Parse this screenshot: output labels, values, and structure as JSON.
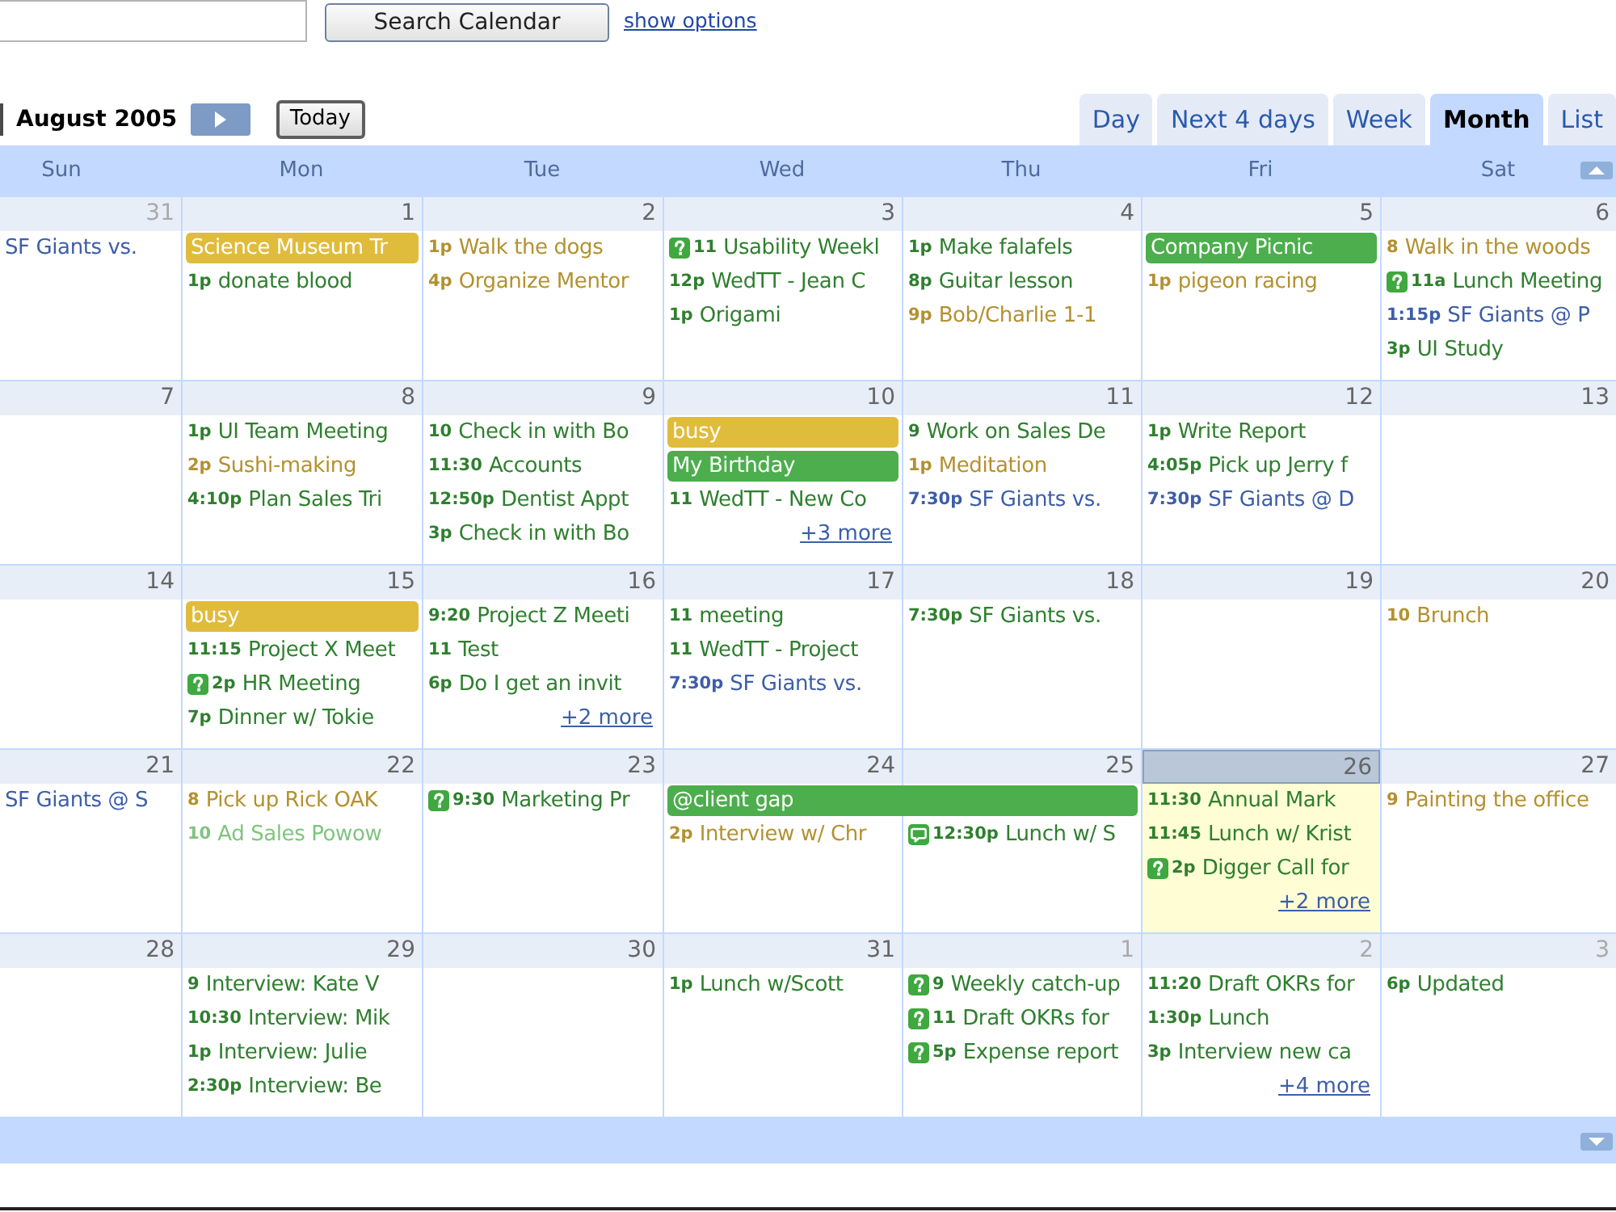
{
  "search": {
    "button": "Search Calendar",
    "link": "show options"
  },
  "navigation": {
    "title": "August 2005",
    "today_button": "Today"
  },
  "views": [
    {
      "label": "Day",
      "selected": false
    },
    {
      "label": "Next 4 days",
      "selected": false
    },
    {
      "label": "Week",
      "selected": false
    },
    {
      "label": "Month",
      "selected": true
    },
    {
      "label": "List",
      "selected": false
    }
  ],
  "weekdays": [
    "Sun",
    "Mon",
    "Tue",
    "Wed",
    "Thu",
    "Fri",
    "Sat"
  ],
  "weeks": [
    {
      "days": [
        {
          "date": "31",
          "outside": true,
          "today": false,
          "events": [
            {
              "kind": "text",
              "title": "SF Giants vs.",
              "color": "#3d5ea8"
            }
          ]
        },
        {
          "date": "1",
          "outside": false,
          "today": false,
          "events": [
            {
              "kind": "chip",
              "title": "Science Museum Tr",
              "color": "#e0bc3c",
              "continues": false
            },
            {
              "kind": "text",
              "time": "1p",
              "title": "donate blood",
              "color": "#2f7f2f"
            }
          ]
        },
        {
          "date": "2",
          "outside": false,
          "today": false,
          "events": [
            {
              "kind": "text",
              "time": "1p",
              "title": "Walk the dogs",
              "color": "#b3912f"
            },
            {
              "kind": "text",
              "time": "4p",
              "title": "Organize Mentor",
              "color": "#b3912f"
            }
          ]
        },
        {
          "date": "3",
          "outside": false,
          "today": false,
          "events": [
            {
              "kind": "invite",
              "time": "11",
              "title": "Usability Weekl",
              "color": "#2f7f2f"
            },
            {
              "kind": "text",
              "time": "12p",
              "title": "WedTT - Jean C",
              "color": "#2f7f2f"
            },
            {
              "kind": "text",
              "time": "1p",
              "title": "Origami",
              "color": "#2f7f2f"
            }
          ]
        },
        {
          "date": "4",
          "outside": false,
          "today": false,
          "events": [
            {
              "kind": "text",
              "time": "1p",
              "title": "Make falafels",
              "color": "#2f7f2f"
            },
            {
              "kind": "text",
              "time": "8p",
              "title": "Guitar lesson",
              "color": "#2f7f2f"
            },
            {
              "kind": "text",
              "time": "9p",
              "title": "Bob/Charlie 1-1",
              "color": "#b3912f"
            }
          ]
        },
        {
          "date": "5",
          "outside": false,
          "today": false,
          "events": [
            {
              "kind": "chip",
              "title": "Company Picnic",
              "color": "#4cae4c",
              "continues": false
            },
            {
              "kind": "text",
              "time": "1p",
              "title": "pigeon racing",
              "color": "#b3912f"
            }
          ]
        },
        {
          "date": "6",
          "outside": false,
          "today": false,
          "events": [
            {
              "kind": "text",
              "time": "8",
              "title": "Walk in the woods",
              "color": "#b3912f"
            },
            {
              "kind": "invite",
              "time": "11a",
              "title": "Lunch Meeting",
              "color": "#2f7f2f"
            },
            {
              "kind": "text",
              "time": "1:15p",
              "title": "SF Giants @ P",
              "color": "#3d5ea8"
            },
            {
              "kind": "text",
              "time": "3p",
              "title": "UI Study",
              "color": "#2f7f2f"
            }
          ]
        }
      ]
    },
    {
      "days": [
        {
          "date": "7",
          "outside": false,
          "today": false
        },
        {
          "date": "8",
          "outside": false,
          "today": false,
          "events": [
            {
              "kind": "text",
              "time": "1p",
              "title": "UI Team Meeting",
              "color": "#2f7f2f"
            },
            {
              "kind": "text",
              "time": "2p",
              "title": "Sushi-making",
              "color": "#b3912f"
            },
            {
              "kind": "text",
              "time": "4:10p",
              "title": "Plan Sales Tri",
              "color": "#2f7f2f"
            }
          ]
        },
        {
          "date": "9",
          "outside": false,
          "today": false,
          "events": [
            {
              "kind": "text",
              "time": "10",
              "title": "Check in with Bo",
              "color": "#2f7f2f"
            },
            {
              "kind": "text",
              "time": "11:30",
              "title": "Accounts",
              "color": "#2f7f2f"
            },
            {
              "kind": "text",
              "time": "12:50p",
              "title": "Dentist Appt",
              "color": "#2f7f2f"
            },
            {
              "kind": "text",
              "time": "3p",
              "title": "Check in with Bo",
              "color": "#2f7f2f"
            }
          ]
        },
        {
          "date": "10",
          "outside": false,
          "today": false,
          "events": [
            {
              "kind": "chip",
              "title": "busy",
              "color": "#e0bc3c",
              "continues": false
            },
            {
              "kind": "chip",
              "title": "My Birthday",
              "color": "#4cae4c",
              "continues": false
            },
            {
              "kind": "text",
              "time": "11",
              "title": "WedTT - New Co",
              "color": "#2f7f2f"
            }
          ],
          "more": "+3 more"
        },
        {
          "date": "11",
          "outside": false,
          "today": false,
          "events": [
            {
              "kind": "text",
              "time": "9",
              "title": "Work on Sales De",
              "color": "#2f7f2f"
            },
            {
              "kind": "text",
              "time": "1p",
              "title": "Meditation",
              "color": "#b3912f"
            },
            {
              "kind": "text",
              "time": "7:30p",
              "title": "SF Giants vs.",
              "color": "#3d5ea8"
            }
          ]
        },
        {
          "date": "12",
          "outside": false,
          "today": false,
          "events": [
            {
              "kind": "text",
              "time": "1p",
              "title": "Write Report",
              "color": "#2f7f2f"
            },
            {
              "kind": "text",
              "time": "4:05p",
              "title": "Pick up Jerry f",
              "color": "#2f7f2f"
            },
            {
              "kind": "text",
              "time": "7:30p",
              "title": "SF Giants @ D",
              "color": "#3d5ea8"
            }
          ]
        },
        {
          "date": "13",
          "outside": false,
          "today": false
        }
      ]
    },
    {
      "days": [
        {
          "date": "14",
          "outside": false,
          "today": false
        },
        {
          "date": "15",
          "outside": false,
          "today": false,
          "events": [
            {
              "kind": "chip",
              "title": "busy",
              "color": "#e0bc3c",
              "continues": false
            },
            {
              "kind": "text",
              "time": "11:15",
              "title": "Project X Meet",
              "color": "#2f7f2f"
            },
            {
              "kind": "invite",
              "time": "2p",
              "title": "HR Meeting",
              "color": "#2f7f2f"
            },
            {
              "kind": "text",
              "time": "7p",
              "title": "Dinner w/ Tokie",
              "color": "#2f7f2f"
            }
          ]
        },
        {
          "date": "16",
          "outside": false,
          "today": false,
          "events": [
            {
              "kind": "text",
              "time": "9:20",
              "title": "Project Z Meeti",
              "color": "#2f7f2f"
            },
            {
              "kind": "text",
              "time": "11",
              "title": "Test",
              "color": "#2f7f2f"
            },
            {
              "kind": "text",
              "time": "6p",
              "title": "Do I get an invit",
              "color": "#2f7f2f"
            }
          ],
          "more": "+2 more"
        },
        {
          "date": "17",
          "outside": false,
          "today": false,
          "events": [
            {
              "kind": "text",
              "time": "11",
              "title": "meeting",
              "color": "#2f7f2f"
            },
            {
              "kind": "text",
              "time": "11",
              "title": "WedTT - Project",
              "color": "#2f7f2f"
            },
            {
              "kind": "text",
              "time": "7:30p",
              "title": "SF Giants vs.",
              "color": "#3d5ea8"
            }
          ]
        },
        {
          "date": "18",
          "outside": false,
          "today": false,
          "events": [
            {
              "kind": "text",
              "time": "7:30p",
              "title": "SF Giants vs.",
              "color": "#2f7f2f"
            }
          ]
        },
        {
          "date": "19",
          "outside": false,
          "today": false
        },
        {
          "date": "20",
          "outside": false,
          "today": false,
          "events": [
            {
              "kind": "text",
              "time": "10",
              "title": "Brunch",
              "color": "#b3912f"
            }
          ]
        }
      ]
    },
    {
      "days": [
        {
          "date": "21",
          "outside": false,
          "today": false,
          "events": [
            {
              "kind": "text",
              "title": "SF Giants @ S",
              "color": "#3d5ea8"
            }
          ]
        },
        {
          "date": "22",
          "outside": false,
          "today": false,
          "events": [
            {
              "kind": "text",
              "time": "8",
              "title": "Pick up Rick OAK",
              "color": "#b3912f"
            },
            {
              "kind": "text",
              "time": "10",
              "title": "Ad Sales Powow",
              "color": "#7fc47f"
            }
          ]
        },
        {
          "date": "23",
          "outside": false,
          "today": false,
          "events": [
            {
              "kind": "invite",
              "time": "9:30",
              "title": "Marketing Pr",
              "color": "#2f7f2f"
            }
          ]
        },
        {
          "date": "24",
          "outside": false,
          "today": false,
          "events": [
            {
              "kind": "chip",
              "title": "@client gap",
              "color": "#4cae4c",
              "continues": true
            },
            {
              "kind": "text",
              "time": "2p",
              "title": "Interview w/ Chr",
              "color": "#b3912f"
            }
          ]
        },
        {
          "date": "25",
          "outside": false,
          "today": false,
          "events": [
            {
              "kind": "chat",
              "time": "12:30p",
              "title": "Lunch w/ S",
              "color": "#2f7f2f"
            }
          ]
        },
        {
          "date": "26",
          "outside": false,
          "today": true,
          "events": [
            {
              "kind": "text",
              "time": "11:30",
              "title": "Annual Mark",
              "color": "#2f7f2f"
            },
            {
              "kind": "text",
              "time": "11:45",
              "title": "Lunch w/ Krist",
              "color": "#2f7f2f"
            },
            {
              "kind": "invite",
              "time": "2p",
              "title": "Digger Call for",
              "color": "#2f7f2f"
            }
          ],
          "more": "+2 more"
        },
        {
          "date": "27",
          "outside": false,
          "today": false,
          "events": [
            {
              "kind": "text",
              "time": "9",
              "title": "Painting the office",
              "color": "#b3912f"
            }
          ]
        }
      ]
    },
    {
      "days": [
        {
          "date": "28",
          "outside": false,
          "today": false
        },
        {
          "date": "29",
          "outside": false,
          "today": false,
          "events": [
            {
              "kind": "text",
              "time": "9",
              "title": "Interview: Kate V",
              "color": "#2f7f2f"
            },
            {
              "kind": "text",
              "time": "10:30",
              "title": "Interview: Mik",
              "color": "#2f7f2f"
            },
            {
              "kind": "text",
              "time": "1p",
              "title": "Interview: Julie",
              "color": "#2f7f2f"
            },
            {
              "kind": "text",
              "time": "2:30p",
              "title": "Interview: Be",
              "color": "#2f7f2f"
            }
          ]
        },
        {
          "date": "30",
          "outside": false,
          "today": false
        },
        {
          "date": "31",
          "outside": false,
          "today": false,
          "events": [
            {
              "kind": "text",
              "time": "1p",
              "title": "Lunch w/Scott",
              "color": "#2f7f2f"
            }
          ]
        },
        {
          "date": "1",
          "outside": true,
          "today": false,
          "events": [
            {
              "kind": "invite",
              "time": "9",
              "title": "Weekly catch-up",
              "color": "#2f7f2f"
            },
            {
              "kind": "invite",
              "time": "11",
              "title": "Draft OKRs for",
              "color": "#2f7f2f"
            },
            {
              "kind": "invite",
              "time": "5p",
              "title": "Expense report",
              "color": "#2f7f2f"
            }
          ]
        },
        {
          "date": "2",
          "outside": true,
          "today": false,
          "events": [
            {
              "kind": "text",
              "time": "11:20",
              "title": "Draft OKRs for",
              "color": "#2f7f2f"
            },
            {
              "kind": "text",
              "time": "1:30p",
              "title": "Lunch",
              "color": "#2f7f2f"
            },
            {
              "kind": "text",
              "time": "3p",
              "title": "Interview new ca",
              "color": "#2f7f2f"
            }
          ],
          "more": "+4 more"
        },
        {
          "date": "3",
          "outside": true,
          "today": false,
          "events": [
            {
              "kind": "text",
              "time": "6p",
              "title": "Updated",
              "color": "#2f7f2f"
            }
          ]
        }
      ]
    }
  ]
}
